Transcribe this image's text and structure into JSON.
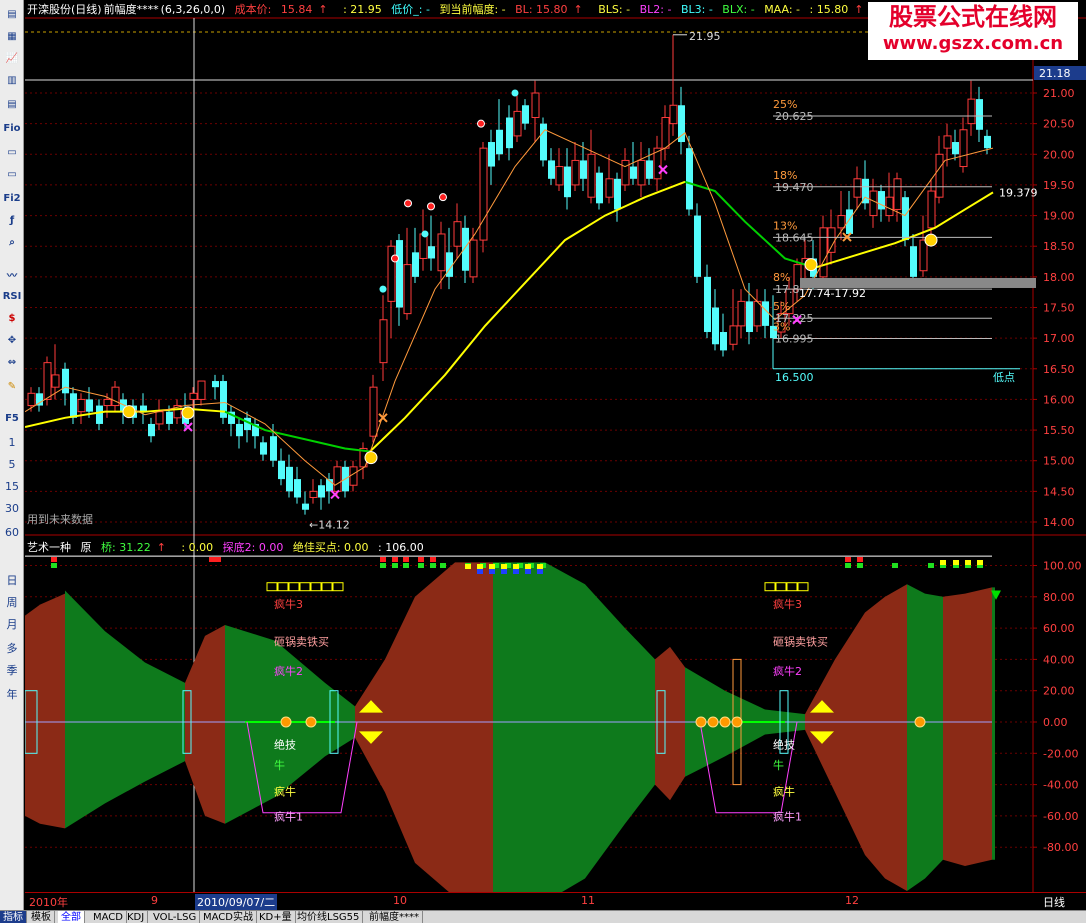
{
  "title_row": {
    "stock": "开滦股份(日线)",
    "indicator": "前幅度****",
    "params": "(6,3,26,0,0)",
    "cost_label": "成本价:",
    "cost_value": "15.84",
    "cost_arrow": "↑",
    "high_value": ": 21.95",
    "low_label": "低价_: -",
    "reach_label": "到当前幅度: -",
    "bl_label": "BL: 15.80",
    "bl_arrow": "↑",
    "bls_label": "BLS: -",
    "bl2_label": "BL2: -",
    "bl3_label": "BL3: -",
    "blx_label": "BLX: -",
    "maa_label": "MAA: -",
    "last_value": ": 15.80",
    "last_arrow": "↑",
    "dash_value": ": -",
    "tail": "_3"
  },
  "watermark": {
    "line1": "股票公式在线网",
    "line2": "www.gszx.com.cn"
  },
  "main_chart": {
    "price_axis": [
      "21.00",
      "20.50",
      "20.00",
      "19.50",
      "19.00",
      "18.50",
      "18.00",
      "17.50",
      "17.00",
      "16.50",
      "16.00",
      "15.50",
      "15.00",
      "14.50",
      "14.00"
    ],
    "current_price": "21.18",
    "ma_last_label": "19.379",
    "high_label": "21.95",
    "low_label": "←14.12",
    "no_future_text": "用到未来数据",
    "fib_labels": [
      {
        "pct": "25%",
        "val": "20.625"
      },
      {
        "pct": "18%",
        "val": "19.470"
      },
      {
        "pct": "13%",
        "val": "18.645"
      },
      {
        "pct": "8%",
        "val": "17.8"
      },
      {
        "pct": "5%",
        "val": "17.325"
      },
      {
        "pct": "3%",
        "val": "16.995"
      }
    ],
    "fib_range": "17.74-17.92",
    "fib_base": "16.500",
    "low_point_label": "低点"
  },
  "sub_row": {
    "name": "艺术一种",
    "orig": "原",
    "bridge": "桥: 31.22",
    "bridge_arrow": "↑",
    "zero_value": ": 0.00",
    "probe_label": "探底2: 0.00",
    "best_label": "绝佳买点: 0.00",
    "value_106": ": 106.00"
  },
  "sub_chart": {
    "axis": [
      "100.00",
      "80.00",
      "60.00",
      "40.00",
      "20.00",
      "0.00",
      "-20.00",
      "-40.00",
      "-60.00",
      "-80.00"
    ],
    "left_labels": {
      "crazy3": "疯牛3",
      "smash": "砸锅卖铁买",
      "crazy2": "疯牛2",
      "unique": "绝技",
      "bull": "牛",
      "crazy_bull": "疯牛",
      "crazy1": "疯牛1"
    },
    "right_labels": {
      "crazy3": "疯牛3",
      "smash": "砸锅卖铁买",
      "crazy2": "疯牛2",
      "unique": "绝技",
      "bull": "牛",
      "crazy_bull": "疯牛",
      "crazy1": "疯牛1"
    }
  },
  "bottom_axis": {
    "labels": [
      "2010年",
      "9",
      "2010/09/07/二",
      "10",
      "11",
      "12"
    ],
    "period": "日线"
  },
  "tabs": [
    "指标",
    "模板",
    "全部",
    "MACD",
    "KDJ",
    "VOL-LSG",
    "MACD实战",
    "KD+量",
    "均价线LSG55",
    "前幅度****"
  ],
  "toolbar": {
    "fn_labels": [
      "Fio",
      "Fi2",
      "F5"
    ],
    "rsi": "RSI",
    "periods": [
      "1",
      "5",
      "15",
      "30",
      "60",
      "日",
      "周",
      "月",
      "多",
      "季",
      "年"
    ]
  },
  "colors": {
    "up": "#ff3b3b",
    "down": "#54fcfc",
    "ma_yellow": "#ffff00",
    "ma_green": "#00d000",
    "ma_orange": "#ff9a3c",
    "red_band": "#8b2a16",
    "green_band": "#0e7a1c",
    "title_red": "#ff4040",
    "title_magenta": "#ff40ff",
    "title_green": "#40ff40"
  }
}
